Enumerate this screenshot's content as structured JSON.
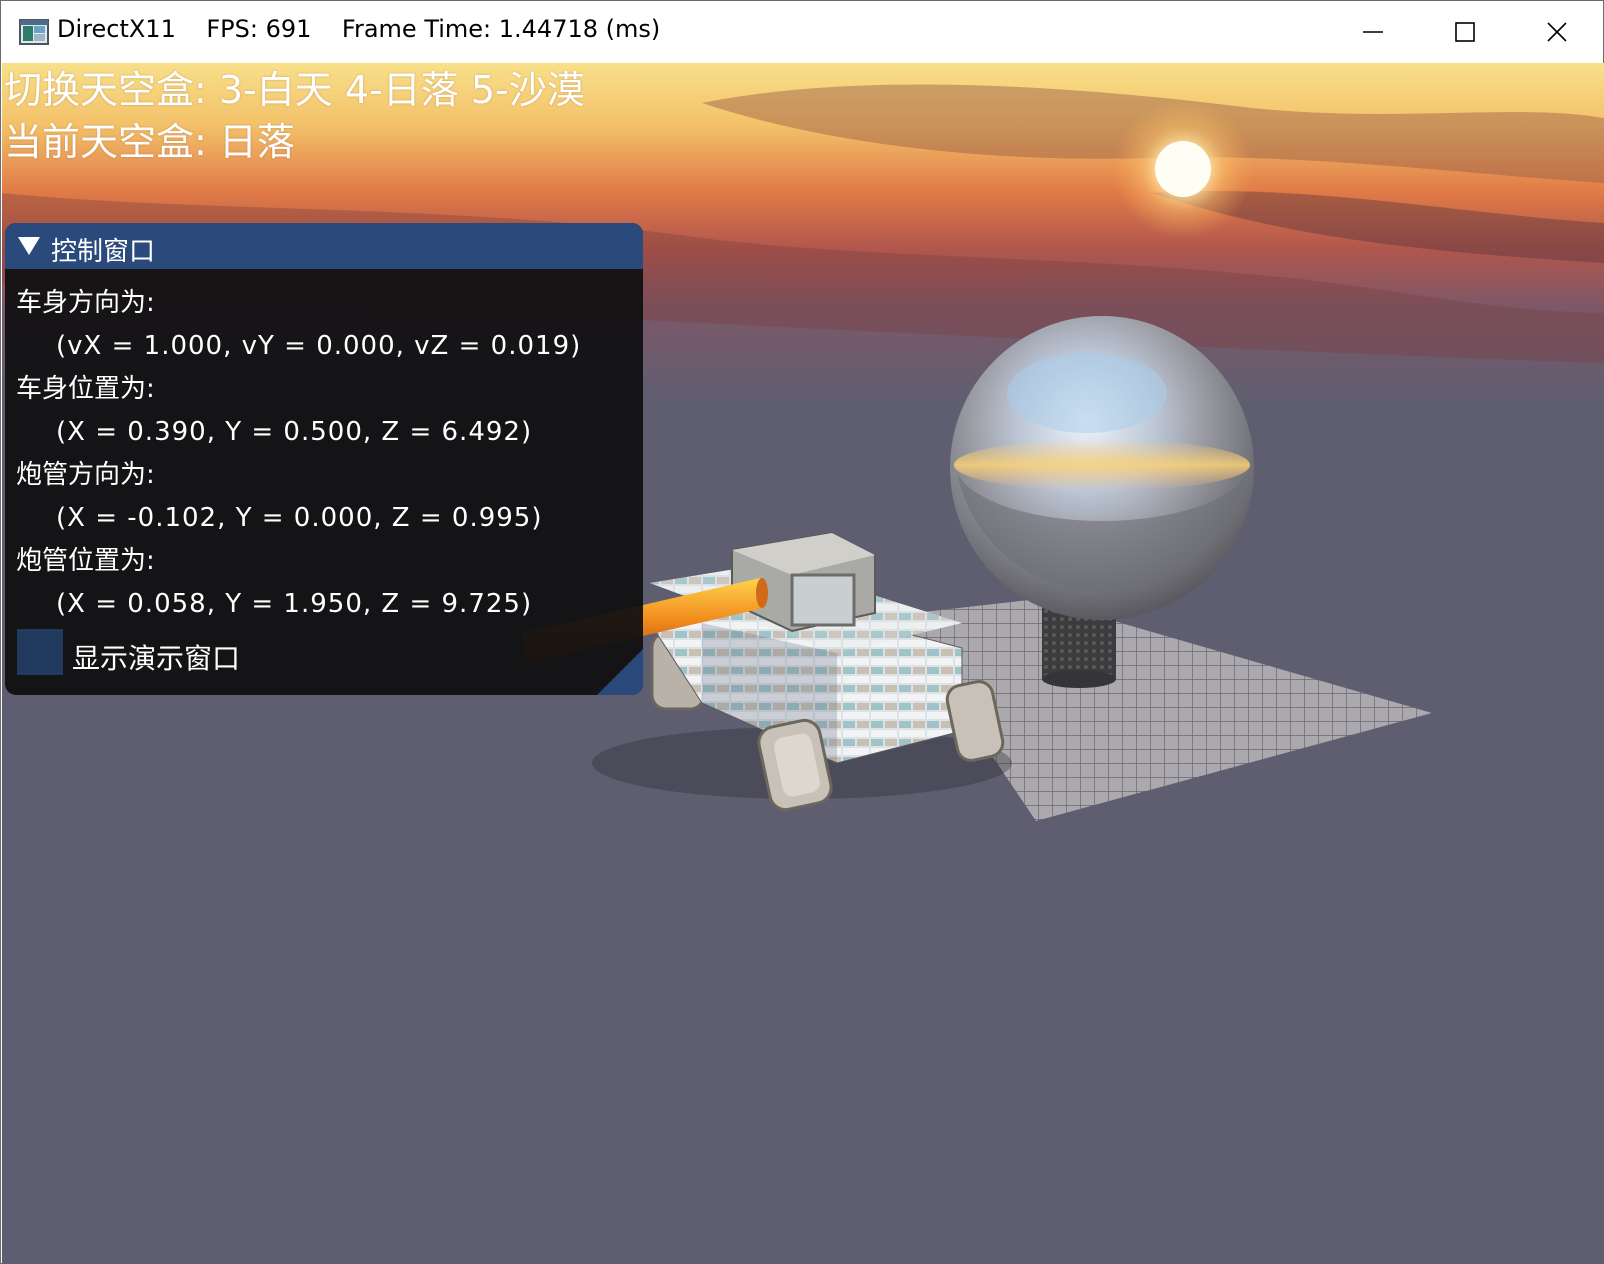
{
  "window": {
    "title": "DirectX11    FPS: 691    Frame Time: 1.44718 (ms)",
    "buttons": {
      "minimize": "minimize-icon",
      "maximize": "maximize-icon",
      "close": "close-icon"
    }
  },
  "hud": {
    "skybox_switch": "切换天空盒: 3-白天 4-日落 5-沙漠",
    "current_skybox": "当前天空盒: 日落"
  },
  "control_panel": {
    "title": "控制窗口",
    "rows": [
      {
        "label": "车身方向为:",
        "value": "(vX = 1.000, vY = 0.000, vZ = 0.019)"
      },
      {
        "label": "车身位置为:",
        "value": "(X = 0.390, Y = 0.500, Z = 6.492)"
      },
      {
        "label": "炮管方向为:",
        "value": "(X = -0.102, Y = 0.000, Z = 0.995)"
      },
      {
        "label": "炮管位置为:",
        "value": "(X = 0.058, Y = 1.950, Z = 9.725)"
      }
    ],
    "checkbox_label": "显示演示窗口",
    "checkbox_checked": false
  },
  "colors": {
    "panel_header": "#294a7a",
    "panel_bg": "#101011",
    "checkbox_bg": "#223a5e",
    "ground_haze": "#5f5e71"
  }
}
